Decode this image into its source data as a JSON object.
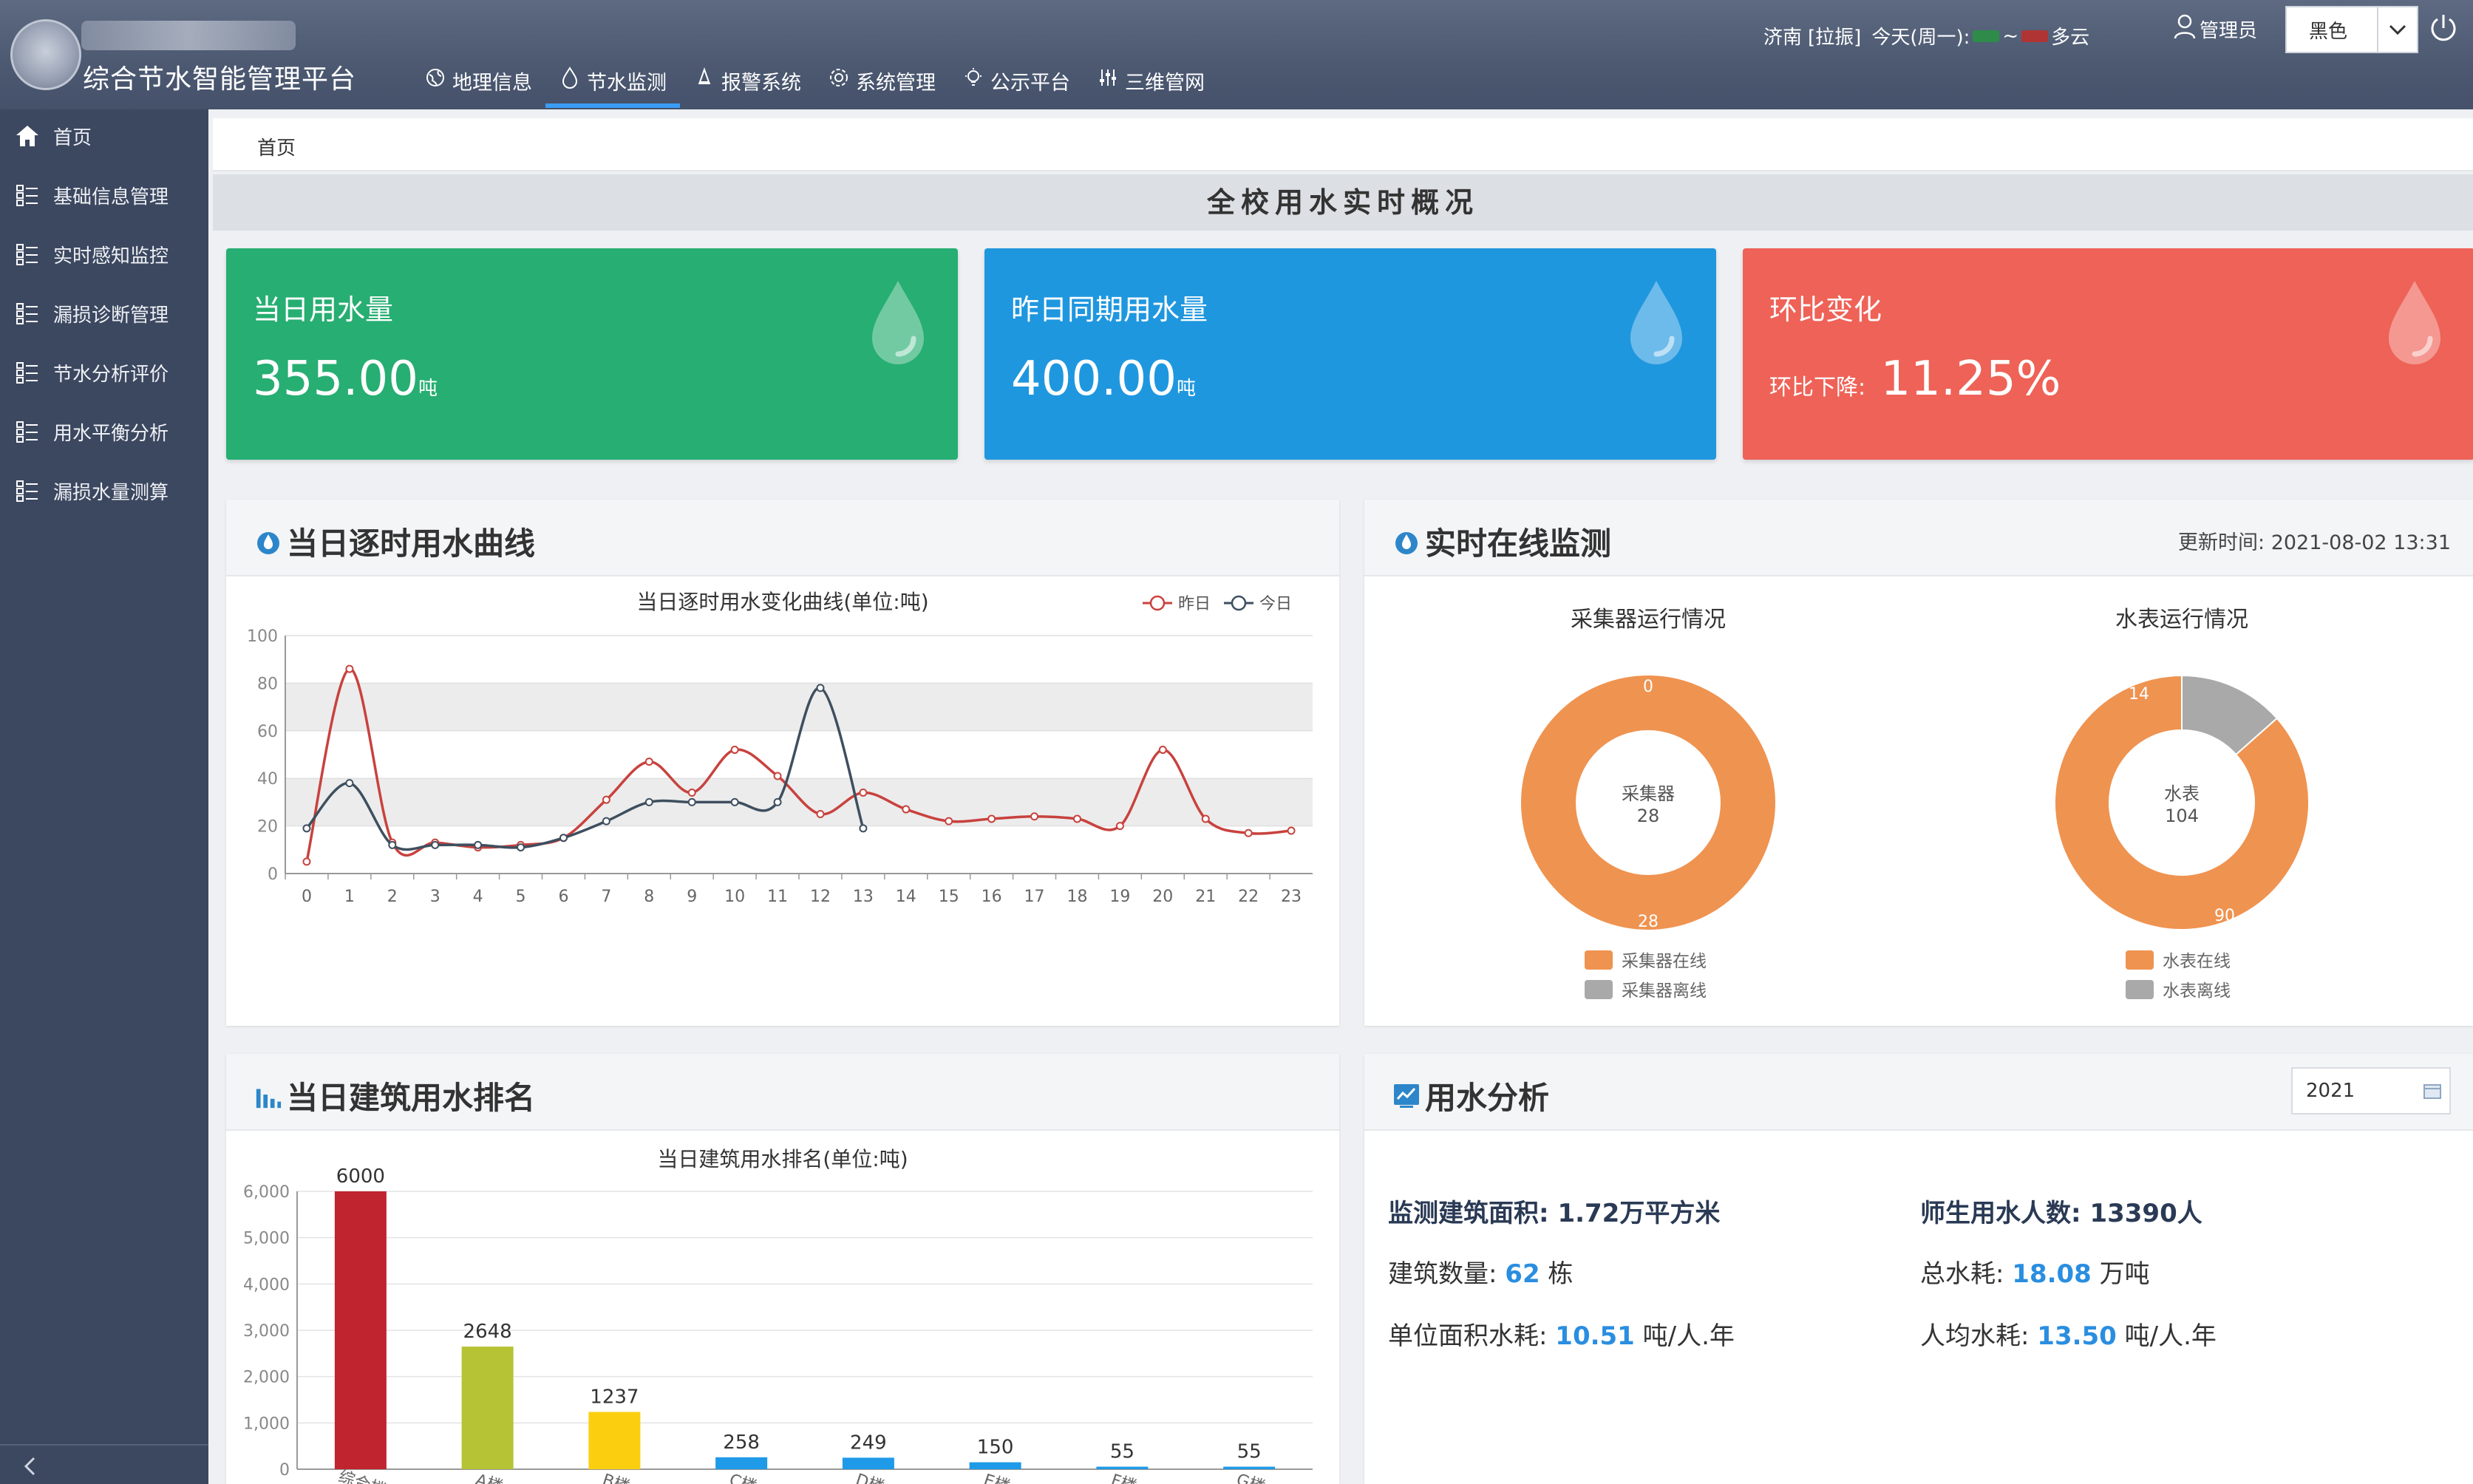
{
  "header": {
    "app_title": "综合节水智能管理平台",
    "nav": [
      {
        "label": "地理信息",
        "icon": "globe-icon",
        "active": false
      },
      {
        "label": "节水监测",
        "icon": "water-drop-icon",
        "active": true
      },
      {
        "label": "报警系统",
        "icon": "bell-icon",
        "active": false
      },
      {
        "label": "系统管理",
        "icon": "gear-icon",
        "active": false
      },
      {
        "label": "公示平台",
        "icon": "lightbulb-icon",
        "active": false
      },
      {
        "label": "三维管网",
        "icon": "sliders-icon",
        "active": false
      }
    ],
    "weather": {
      "city": "济南",
      "aqi": "[拉振]",
      "today": "今天(周一):",
      "sep": "~",
      "desc": "多云"
    },
    "user": "管理员",
    "theme": "黑色"
  },
  "sidebar": {
    "items": [
      {
        "label": "首页",
        "icon": "home-icon"
      },
      {
        "label": "基础信息管理",
        "icon": "grid-list-icon"
      },
      {
        "label": "实时感知监控",
        "icon": "grid-list-icon"
      },
      {
        "label": "漏损诊断管理",
        "icon": "grid-list-icon"
      },
      {
        "label": "节水分析评价",
        "icon": "grid-list-icon"
      },
      {
        "label": "用水平衡分析",
        "icon": "grid-list-icon"
      },
      {
        "label": "漏损水量测算",
        "icon": "grid-list-icon"
      }
    ]
  },
  "breadcrumb": "首页",
  "section_title": "全校用水实时概况",
  "kpis": [
    {
      "label": "当日用水量",
      "value": "355.00",
      "unit": "吨",
      "color": "#27ae72"
    },
    {
      "label": "昨日同期用水量",
      "value": "400.00",
      "unit": "吨",
      "color": "#1f97df"
    },
    {
      "label": "环比变化",
      "change_label": "环比下降:",
      "value": "11.25%",
      "color": "#ee6257"
    }
  ],
  "hourly_panel": {
    "title": "当日逐时用水曲线"
  },
  "monitor_panel": {
    "title": "实时在线监测",
    "update_label": "更新时间:",
    "update_time": "2021-08-02 13:31",
    "collector": {
      "title": "采集器运行情况",
      "center_label": "采集器",
      "center_value": "28",
      "online": 28,
      "offline": 0,
      "legend_online": "采集器在线",
      "legend_offline": "采集器离线"
    },
    "meter": {
      "title": "水表运行情况",
      "center_label": "水表",
      "center_value": "104",
      "online": 90,
      "offline": 14,
      "legend_online": "水表在线",
      "legend_offline": "水表离线"
    },
    "colors": {
      "online": "#ef9350",
      "offline": "#a9a9a9"
    }
  },
  "ranking_panel": {
    "title": "当日建筑用水排名"
  },
  "analysis_panel": {
    "title": "用水分析",
    "year": "2021",
    "area_label": "监测建筑面积:",
    "area_value": "1.72万平方米",
    "people_label": "师生用水人数:",
    "people_value": "13390人",
    "building_label": "建筑数量:",
    "building_value": "62",
    "building_unit": "栋",
    "total_label": "总水耗:",
    "total_value": "18.08",
    "total_unit": "万吨",
    "unit_area_label": "单位面积水耗:",
    "unit_area_value": "10.51",
    "unit_area_unit": "吨/人.年",
    "per_capita_label": "人均水耗:",
    "per_capita_value": "13.50",
    "per_capita_unit": "吨/人.年"
  },
  "chart_data": [
    {
      "type": "line",
      "title": "当日逐时用水变化曲线(单位:吨)",
      "x": [
        "0",
        "1",
        "2",
        "3",
        "4",
        "5",
        "6",
        "7",
        "8",
        "9",
        "10",
        "11",
        "12",
        "13",
        "14",
        "15",
        "16",
        "17",
        "18",
        "19",
        "20",
        "21",
        "22",
        "23"
      ],
      "ylim": [
        0,
        100
      ],
      "yticks": [
        0,
        20,
        40,
        60,
        80,
        100
      ],
      "series": [
        {
          "name": "昨日",
          "color": "#c8423e",
          "values": [
            5,
            86,
            13,
            13,
            11,
            12,
            15,
            31,
            47,
            34,
            52,
            41,
            25,
            34,
            27,
            22,
            23,
            24,
            23,
            20,
            52,
            23,
            17,
            18
          ]
        },
        {
          "name": "今日",
          "color": "#3e4f5f",
          "values": [
            19,
            38,
            12,
            12,
            12,
            11,
            15,
            22,
            30,
            30,
            30,
            30,
            78,
            19
          ]
        }
      ],
      "legend": "top-right"
    },
    {
      "type": "bar",
      "title": "当日建筑用水排名(单位:吨)",
      "ylim": [
        0,
        6000
      ],
      "yticks": [
        "0",
        "1,000",
        "2,000",
        "3,000",
        "4,000",
        "5,000",
        "6,000"
      ],
      "categories": [
        "综合楼",
        "A楼",
        "B楼",
        "C楼",
        "D楼",
        "E楼",
        "F楼",
        "G楼"
      ],
      "values": [
        6000,
        2648,
        1237,
        258,
        249,
        150,
        55,
        55
      ],
      "colors": [
        "#c0242f",
        "#b5c334",
        "#fcce10",
        "#1f9ae8",
        "#1f9ae8",
        "#1f9ae8",
        "#1f9ae8",
        "#1f9ae8"
      ]
    }
  ]
}
